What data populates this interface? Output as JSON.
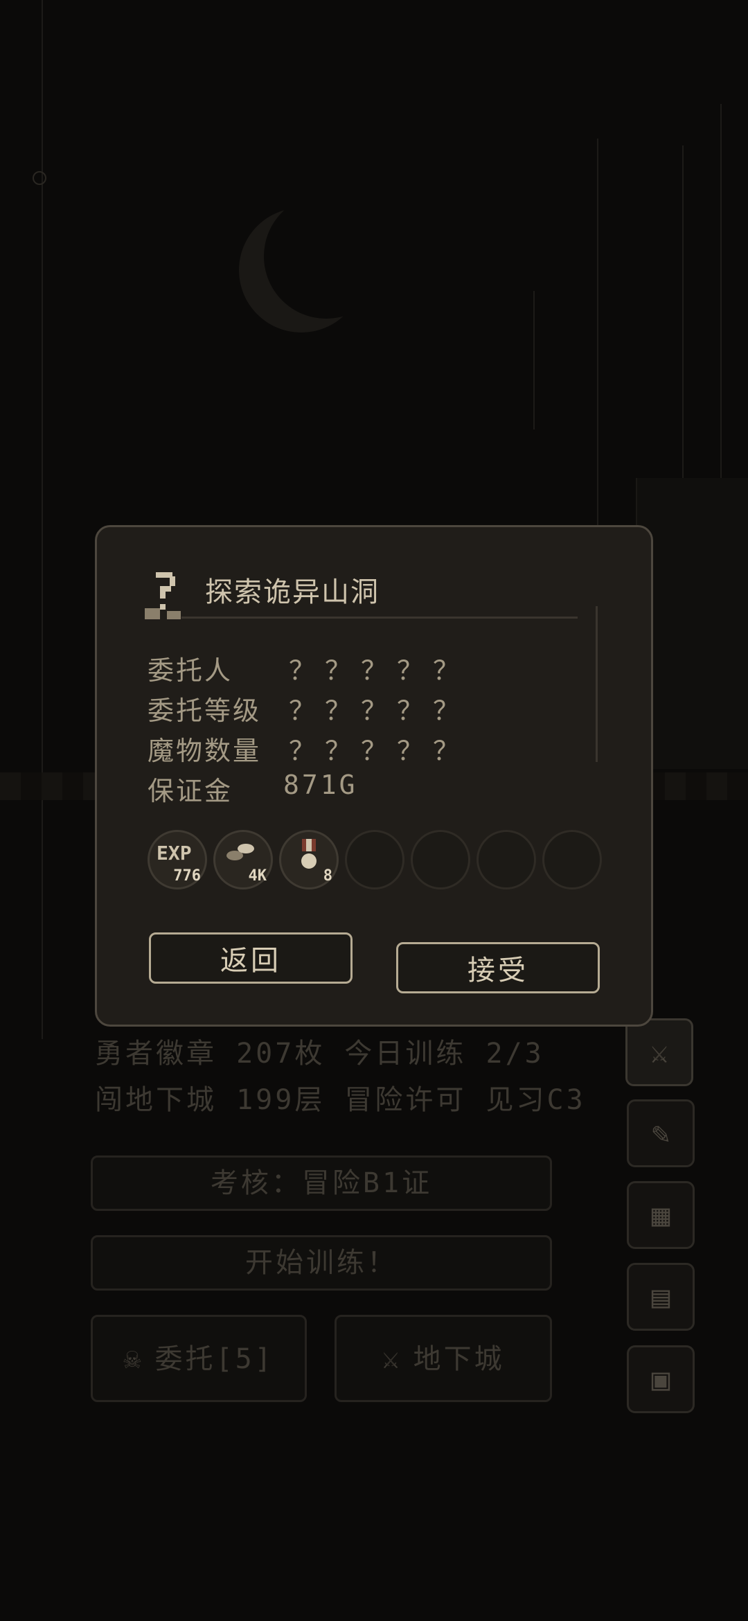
{
  "dialog": {
    "title": "探索诡异山洞",
    "rows": [
      {
        "label": "委托人",
        "value": "？？？？？"
      },
      {
        "label": "委托等级",
        "value": "？？？？？"
      },
      {
        "label": "魔物数量",
        "value": "？？？？？"
      },
      {
        "label": "保证金",
        "value": "871G"
      }
    ],
    "rewards": [
      {
        "icon": "exp-icon",
        "label": "EXP",
        "count": "776"
      },
      {
        "icon": "coins-icon",
        "label": "",
        "count": "4K"
      },
      {
        "icon": "medal-icon",
        "label": "",
        "count": "8"
      }
    ],
    "back_label": "返回",
    "accept_label": "接受"
  },
  "background": {
    "stats_line1": "勇者徽章 207枚  今日训练 2/3",
    "stats_line2": "闯地下城 199层  冒险许可 见习C3",
    "exam_button": "考核：冒险B1证",
    "train_button": "开始训练！",
    "quest_button": "委托[5]",
    "dungeon_button": "地下城",
    "side_icons": [
      "sword-icon",
      "scroll-icon",
      "map-icon",
      "book-icon",
      "computer-icon"
    ]
  },
  "colors": {
    "dialog_bg": "#201d19",
    "dialog_border": "#4d473e",
    "text": "#cfc4ad",
    "dim_text": "#3d3932"
  }
}
